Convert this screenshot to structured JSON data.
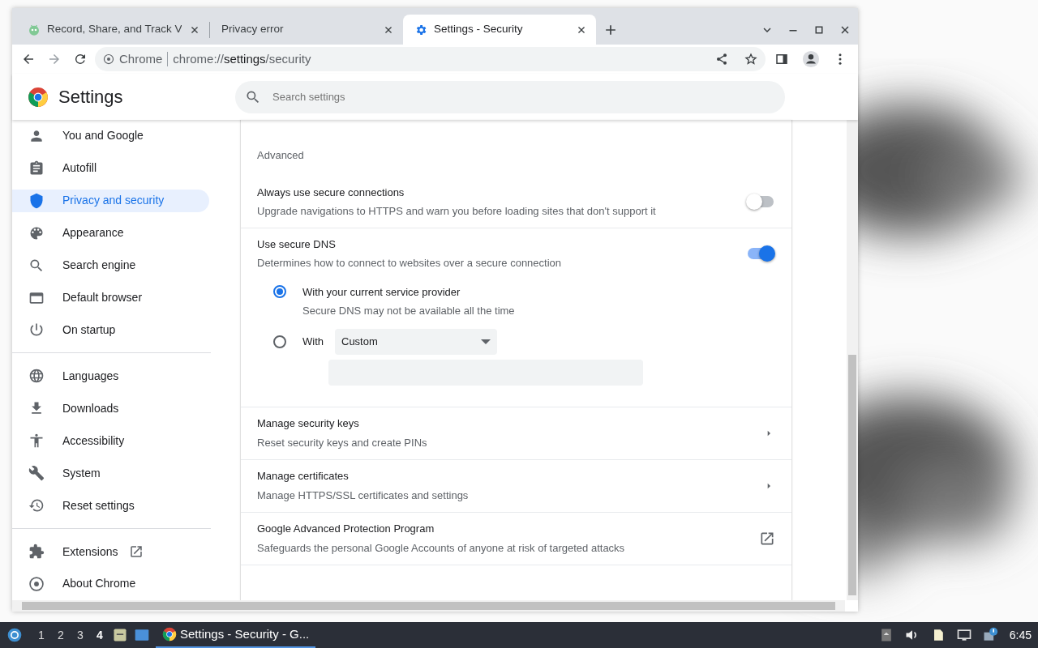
{
  "browser": {
    "tabs": [
      {
        "title": "Record, Share, and Track V",
        "selected": false
      },
      {
        "title": "Privacy error",
        "selected": false
      },
      {
        "title": "Settings - Security",
        "selected": true
      }
    ],
    "omnibox": {
      "site_label": "Chrome",
      "url_scheme": "chrome://",
      "url_host": "settings",
      "url_path": "/security"
    }
  },
  "header": {
    "title": "Settings",
    "search": {
      "placeholder": "Search settings"
    }
  },
  "sidebar": {
    "groups": [
      {
        "items": [
          {
            "label": "You and Google",
            "selected": false
          },
          {
            "label": "Autofill",
            "selected": false
          },
          {
            "label": "Privacy and security",
            "selected": true
          },
          {
            "label": "Appearance",
            "selected": false
          },
          {
            "label": "Search engine",
            "selected": false
          },
          {
            "label": "Default browser",
            "selected": false
          },
          {
            "label": "On startup",
            "selected": false
          }
        ]
      },
      {
        "items": [
          {
            "label": "Languages",
            "selected": false
          },
          {
            "label": "Downloads",
            "selected": false
          },
          {
            "label": "Accessibility",
            "selected": false
          },
          {
            "label": "System",
            "selected": false
          },
          {
            "label": "Reset settings",
            "selected": false
          }
        ]
      },
      {
        "items": [
          {
            "label": "Extensions",
            "selected": false,
            "external": true
          },
          {
            "label": "About Chrome",
            "selected": false
          }
        ]
      }
    ]
  },
  "main": {
    "section_label": "Advanced",
    "rows": [
      {
        "kind": "toggle",
        "title": "Always use secure connections",
        "subtitle": "Upgrade navigations to HTTPS and warn you before loading sites that don't support it",
        "on": false
      },
      {
        "kind": "toggle",
        "title": "Use secure DNS",
        "subtitle": "Determines how to connect to websites over a secure connection",
        "on": true,
        "options": [
          {
            "kind": "plain",
            "label": "With your current service provider",
            "sublabel": "Secure DNS may not be available all the time",
            "selected": true
          },
          {
            "kind": "custom",
            "label": "With",
            "dropdown": "Custom",
            "selected": false
          }
        ]
      },
      {
        "kind": "arrow",
        "title": "Manage security keys",
        "subtitle": "Reset security keys and create PINs"
      },
      {
        "kind": "arrow",
        "title": "Manage certificates",
        "subtitle": "Manage HTTPS/SSL certificates and settings"
      },
      {
        "kind": "external",
        "title": "Google Advanced Protection Program",
        "subtitle": "Safeguards the personal Google Accounts of anyone at risk of targeted attacks"
      }
    ]
  },
  "taskbar": {
    "workspaces": [
      {
        "label": "1",
        "selected": false
      },
      {
        "label": "2",
        "selected": false
      },
      {
        "label": "3",
        "selected": false
      },
      {
        "label": "4",
        "selected": true
      }
    ],
    "task": "Settings - Security - G...",
    "clock": "6:45"
  }
}
